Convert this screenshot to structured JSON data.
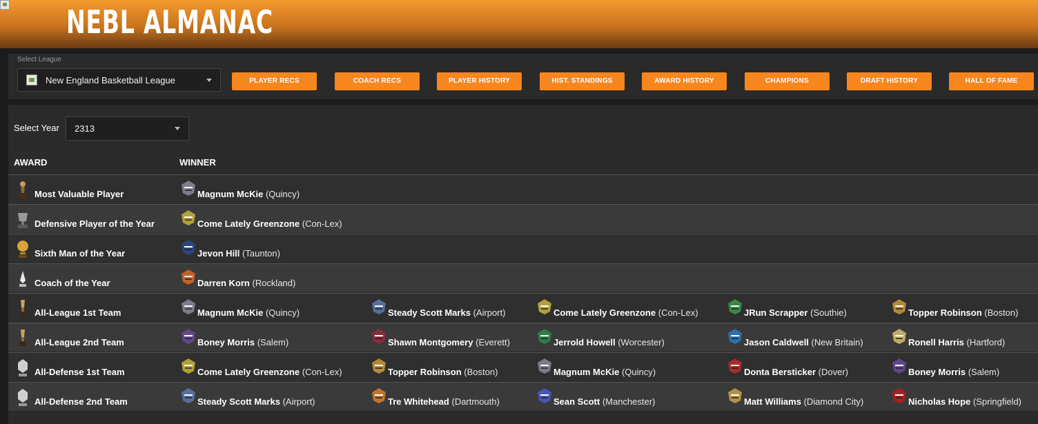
{
  "header": {
    "title": "NEBL ALMANAC"
  },
  "league": {
    "select_label": "Select League",
    "selected": "New England Basketball League"
  },
  "nav": [
    {
      "label": "PLAYER RECS"
    },
    {
      "label": "COACH RECS"
    },
    {
      "label": "PLAYER HISTORY"
    },
    {
      "label": "HIST. STANDINGS"
    },
    {
      "label": "AWARD HISTORY"
    },
    {
      "label": "CHAMPIONS"
    },
    {
      "label": "DRAFT HISTORY"
    },
    {
      "label": "HALL OF FAME"
    }
  ],
  "year": {
    "label": "Select Year",
    "selected": "2313"
  },
  "table": {
    "headers": {
      "award": "AWARD",
      "winner": "WINNER"
    },
    "rows": [
      {
        "award": "Most Valuable Player",
        "trophy": "mvp-trophy-icon",
        "winners": [
          {
            "player": "Magnum McKie",
            "team": "(Quincy)",
            "logo": "quincy-logo-icon",
            "color": "#8a8a9a"
          }
        ]
      },
      {
        "award": "Defensive Player of the Year",
        "trophy": "dpoy-trophy-icon",
        "winners": [
          {
            "player": "Come Lately Greenzone",
            "team": "(Con-Lex)",
            "logo": "con-lex-logo-icon",
            "color": "#c9b53a"
          }
        ]
      },
      {
        "award": "Sixth Man of the Year",
        "trophy": "sixth-man-trophy-icon",
        "winners": [
          {
            "player": "Jevon Hill",
            "team": "(Taunton)",
            "logo": "taunton-logo-icon",
            "color": "#2a4a8a"
          }
        ]
      },
      {
        "award": "Coach of the Year",
        "trophy": "coach-trophy-icon",
        "winners": [
          {
            "player": "Darren Korn",
            "team": "(Rockland)",
            "logo": "rockland-logo-icon",
            "color": "#d86a2a"
          }
        ]
      },
      {
        "award": "All-League 1st Team",
        "trophy": "all-league-trophy-icon",
        "winners": [
          {
            "player": "Magnum McKie",
            "team": "(Quincy)",
            "logo": "quincy-logo-icon",
            "color": "#8a8a9a"
          },
          {
            "player": "Steady Scott Marks",
            "team": "(Airport)",
            "logo": "airport-logo-icon",
            "color": "#5a7ab0"
          },
          {
            "player": "Come Lately Greenzone",
            "team": "(Con-Lex)",
            "logo": "con-lex-logo-icon",
            "color": "#c9b53a"
          },
          {
            "player": "JRun Scrapper",
            "team": "(Southie)",
            "logo": "southie-logo-icon",
            "color": "#3a9a4a"
          },
          {
            "player": "Topper Robinson",
            "team": "(Boston)",
            "logo": "boston-logo-icon",
            "color": "#c99a3a"
          }
        ]
      },
      {
        "award": "All-League 2nd Team",
        "trophy": "all-league-trophy-icon",
        "winners": [
          {
            "player": "Boney Morris",
            "team": "(Salem)",
            "logo": "salem-logo-icon",
            "color": "#6a4a9a"
          },
          {
            "player": "Shawn Montgomery",
            "team": "(Everett)",
            "logo": "everett-logo-icon",
            "color": "#9a2a3a"
          },
          {
            "player": "Jerrold Howell",
            "team": "(Worcester)",
            "logo": "worcester-logo-icon",
            "color": "#2a8a4a"
          },
          {
            "player": "Jason Caldwell",
            "team": "(New Britain)",
            "logo": "new-britain-logo-icon",
            "color": "#2a7ac0"
          },
          {
            "player": "Ronell Harris",
            "team": "(Hartford)",
            "logo": "hartford-logo-icon",
            "color": "#d8c070"
          }
        ]
      },
      {
        "award": "All-Defense 1st Team",
        "trophy": "all-defense-trophy-icon",
        "winners": [
          {
            "player": "Come Lately Greenzone",
            "team": "(Con-Lex)",
            "logo": "con-lex-logo-icon",
            "color": "#c9b53a"
          },
          {
            "player": "Topper Robinson",
            "team": "(Boston)",
            "logo": "boston-logo-icon",
            "color": "#c99a3a"
          },
          {
            "player": "Magnum McKie",
            "team": "(Quincy)",
            "logo": "quincy-logo-icon",
            "color": "#8a8a9a"
          },
          {
            "player": "Donta Bersticker",
            "team": "(Dover)",
            "logo": "dover-logo-icon",
            "color": "#c02a2a"
          },
          {
            "player": "Boney Morris",
            "team": "(Salem)",
            "logo": "salem-logo-icon",
            "color": "#6a4a9a"
          }
        ]
      },
      {
        "award": "All-Defense 2nd Team",
        "trophy": "all-defense-trophy-icon",
        "winners": [
          {
            "player": "Steady Scott Marks",
            "team": "(Airport)",
            "logo": "airport-logo-icon",
            "color": "#5a7ab0"
          },
          {
            "player": "Tre Whitehead",
            "team": "(Dartmouth)",
            "logo": "dartmouth-logo-icon",
            "color": "#d8802a"
          },
          {
            "player": "Sean Scott",
            "team": "(Manchester)",
            "logo": "manchester-logo-icon",
            "color": "#4a5ad0"
          },
          {
            "player": "Matt Williams",
            "team": "(Diamond City)",
            "logo": "diamond-city-logo-icon",
            "color": "#c9a04a"
          },
          {
            "player": "Nicholas Hope",
            "team": "(Springfield)",
            "logo": "springfield-logo-icon",
            "color": "#c01a1a"
          }
        ]
      }
    ]
  },
  "colors": {
    "accent": "#f7861f",
    "panel": "#2b2b2b",
    "row_alt": "#3a3a3a"
  }
}
